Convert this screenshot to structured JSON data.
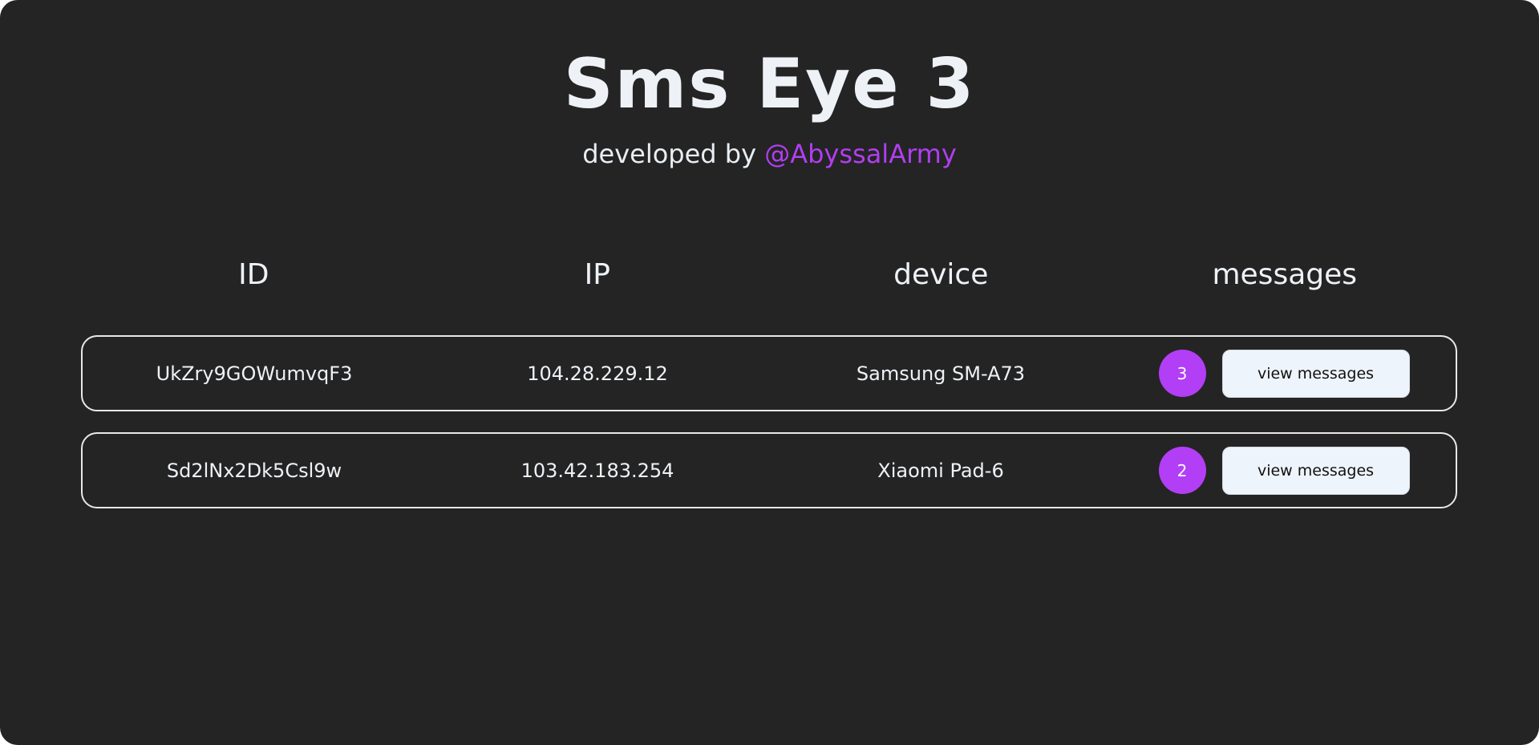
{
  "header": {
    "title": "Sms Eye 3",
    "subtitle_prefix": "developed by ",
    "subtitle_handle": "@AbyssalArmy"
  },
  "table": {
    "columns": [
      "ID",
      "IP",
      "device",
      "messages"
    ],
    "rows": [
      {
        "id": "UkZry9GOWumvqF3",
        "ip": "104.28.229.12",
        "device": "Samsung SM-A73",
        "count": "3",
        "action": "view messages"
      },
      {
        "id": "Sd2lNx2Dk5Csl9w",
        "ip": "103.42.183.254",
        "device": "Xiaomi Pad-6",
        "count": "2",
        "action": "view messages"
      }
    ]
  },
  "colors": {
    "background": "#242424",
    "accent": "#b23ef5",
    "text": "#eef2f7",
    "button": "#eef4fb"
  }
}
